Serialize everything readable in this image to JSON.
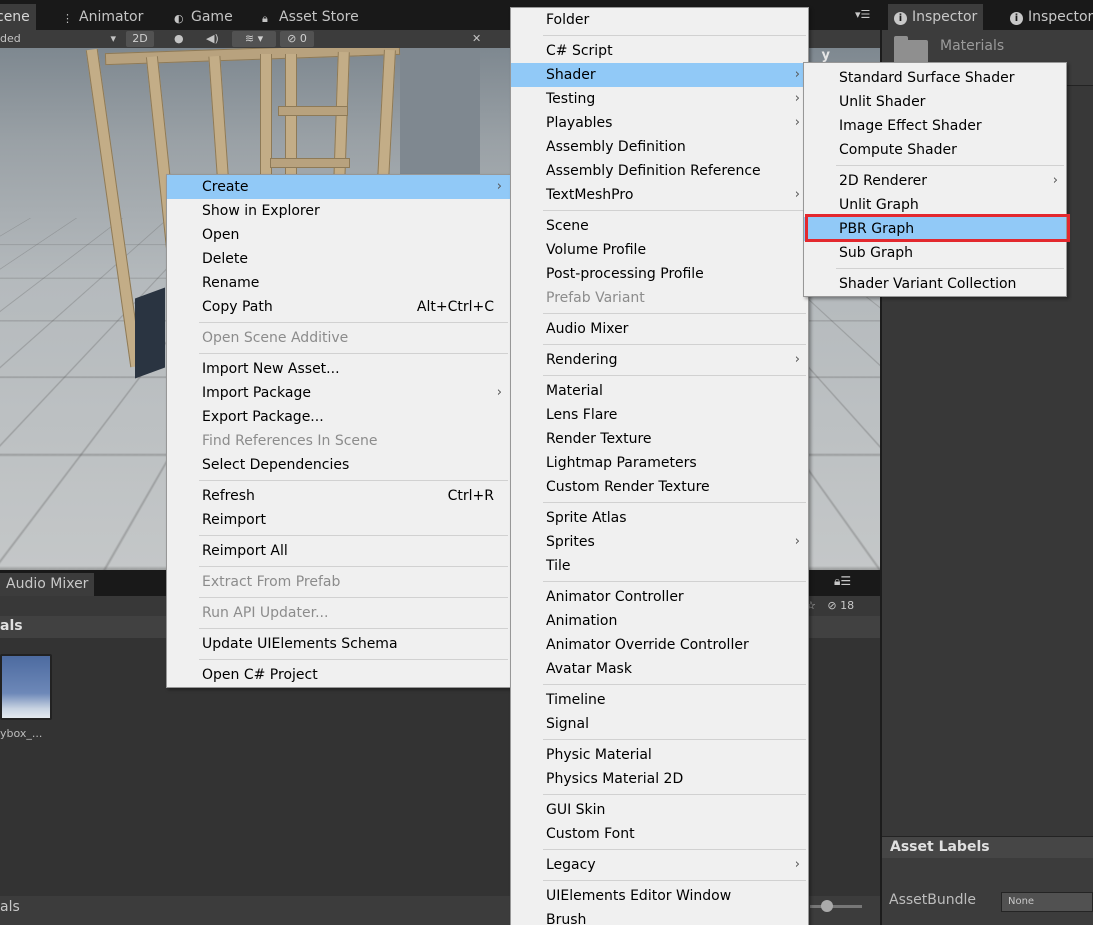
{
  "editor": {
    "tabs": [
      {
        "label": "cene",
        "icon": "scene-icon"
      },
      {
        "label": "Animator",
        "icon": "animator-icon"
      },
      {
        "label": "Game",
        "icon": "game-icon"
      },
      {
        "label": "Asset Store",
        "icon": "lock-icon"
      }
    ],
    "toolbar": {
      "shading_mode": "ded",
      "mode_2d": "2D",
      "hidden_count": "0"
    },
    "gizmo_axis": "y",
    "bottom_tab": "Audio Mixer",
    "project": {
      "breadcrumb": "als",
      "thumbnail_label": "ybox_...",
      "hidden_count": "18",
      "footer_label": "als"
    }
  },
  "inspector": {
    "tabs": [
      {
        "label": "Inspector"
      },
      {
        "label": "Inspector"
      }
    ],
    "title": "Materials",
    "asset_labels_title": "Asset Labels",
    "assetbundle_label": "AssetBundle",
    "assetbundle_value": "None"
  },
  "menu_project": [
    {
      "label": "Create",
      "submenu": true,
      "highlighted": true
    },
    {
      "label": "Show in Explorer"
    },
    {
      "label": "Open"
    },
    {
      "label": "Delete"
    },
    {
      "label": "Rename"
    },
    {
      "label": "Copy Path",
      "shortcut": "Alt+Ctrl+C"
    },
    {
      "separator": true
    },
    {
      "label": "Open Scene Additive",
      "disabled": true
    },
    {
      "separator": true
    },
    {
      "label": "Import New Asset..."
    },
    {
      "label": "Import Package",
      "submenu": true
    },
    {
      "label": "Export Package..."
    },
    {
      "label": "Find References In Scene",
      "disabled": true
    },
    {
      "label": "Select Dependencies"
    },
    {
      "separator": true
    },
    {
      "label": "Refresh",
      "shortcut": "Ctrl+R"
    },
    {
      "label": "Reimport"
    },
    {
      "separator": true
    },
    {
      "label": "Reimport All"
    },
    {
      "separator": true
    },
    {
      "label": "Extract From Prefab",
      "disabled": true
    },
    {
      "separator": true
    },
    {
      "label": "Run API Updater...",
      "disabled": true
    },
    {
      "separator": true
    },
    {
      "label": "Update UIElements Schema"
    },
    {
      "separator": true
    },
    {
      "label": "Open C# Project"
    }
  ],
  "menu_create": [
    {
      "label": "Folder"
    },
    {
      "separator": true
    },
    {
      "label": "C# Script"
    },
    {
      "label": "Shader",
      "submenu": true,
      "highlighted": true
    },
    {
      "label": "Testing",
      "submenu": true
    },
    {
      "label": "Playables",
      "submenu": true
    },
    {
      "label": "Assembly Definition"
    },
    {
      "label": "Assembly Definition Reference"
    },
    {
      "label": "TextMeshPro",
      "submenu": true
    },
    {
      "separator": true
    },
    {
      "label": "Scene"
    },
    {
      "label": "Volume Profile"
    },
    {
      "label": "Post-processing Profile"
    },
    {
      "label": "Prefab Variant",
      "disabled": true
    },
    {
      "separator": true
    },
    {
      "label": "Audio Mixer"
    },
    {
      "separator": true
    },
    {
      "label": "Rendering",
      "submenu": true
    },
    {
      "separator": true
    },
    {
      "label": "Material"
    },
    {
      "label": "Lens Flare"
    },
    {
      "label": "Render Texture"
    },
    {
      "label": "Lightmap Parameters"
    },
    {
      "label": "Custom Render Texture"
    },
    {
      "separator": true
    },
    {
      "label": "Sprite Atlas"
    },
    {
      "label": "Sprites",
      "submenu": true
    },
    {
      "label": "Tile"
    },
    {
      "separator": true
    },
    {
      "label": "Animator Controller"
    },
    {
      "label": "Animation"
    },
    {
      "label": "Animator Override Controller"
    },
    {
      "label": "Avatar Mask"
    },
    {
      "separator": true
    },
    {
      "label": "Timeline"
    },
    {
      "label": "Signal"
    },
    {
      "separator": true
    },
    {
      "label": "Physic Material"
    },
    {
      "label": "Physics Material 2D"
    },
    {
      "separator": true
    },
    {
      "label": "GUI Skin"
    },
    {
      "label": "Custom Font"
    },
    {
      "separator": true
    },
    {
      "label": "Legacy",
      "submenu": true
    },
    {
      "separator": true
    },
    {
      "label": "UIElements Editor Window"
    },
    {
      "label": "Brush"
    }
  ],
  "menu_shader": [
    {
      "label": "Standard Surface Shader"
    },
    {
      "label": "Unlit Shader"
    },
    {
      "label": "Image Effect Shader"
    },
    {
      "label": "Compute Shader"
    },
    {
      "separator": true
    },
    {
      "label": "2D Renderer",
      "submenu": true
    },
    {
      "label": "Unlit Graph"
    },
    {
      "label": "PBR Graph",
      "highlighted": true
    },
    {
      "label": "Sub Graph"
    },
    {
      "separator": true
    },
    {
      "label": "Shader Variant Collection"
    }
  ],
  "arrow_glyph": "›",
  "colors": {
    "menu_bg": "#f0f0f0",
    "menu_highlight": "#91c9f7",
    "annotation_outline": "#e3282e",
    "editor_dark": "#282828"
  }
}
